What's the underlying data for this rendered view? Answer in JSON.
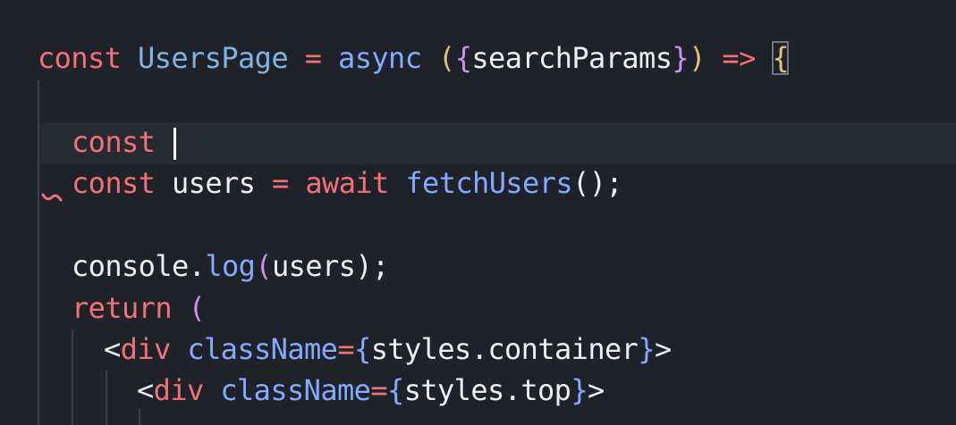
{
  "editor": {
    "lines": {
      "l1": {
        "t1": "const",
        "t2": "UsersPage",
        "t3": "=",
        "t4": "async",
        "t5": "(",
        "t6": "{",
        "t7": "searchParams",
        "t8": "}",
        "t9": ")",
        "t10": "=>",
        "t11": "{"
      },
      "l2": {
        "t1": "const"
      },
      "l3": {
        "t1": "const",
        "t2": "users",
        "t3": "=",
        "t4": "await",
        "t5": "fetchUsers",
        "t6": "();"
      },
      "l4": {
        "t1": "console.",
        "t2": "log",
        "t3": "(",
        "t4": "users",
        "t5": ");"
      },
      "l5": {
        "t1": "return",
        "t2": "("
      },
      "l6": {
        "t1": "<",
        "t2": "div",
        "t3": "className",
        "t4": "=",
        "t5": "{",
        "t6": "styles.container",
        "t7": "}",
        "t8": ">"
      },
      "l7": {
        "t1": "<",
        "t2": "div",
        "t3": "className",
        "t4": "=",
        "t5": "{",
        "t6": "styles.top",
        "t7": "}",
        "t8": ">"
      }
    }
  },
  "colors": {
    "background": "#1f2229",
    "keyword": "#f07178",
    "function": "#82aaff",
    "identifier": "#eceff4",
    "bracket_gold": "#e5c07b",
    "bracket_purple": "#c792ea",
    "caret": "#ffffff"
  }
}
